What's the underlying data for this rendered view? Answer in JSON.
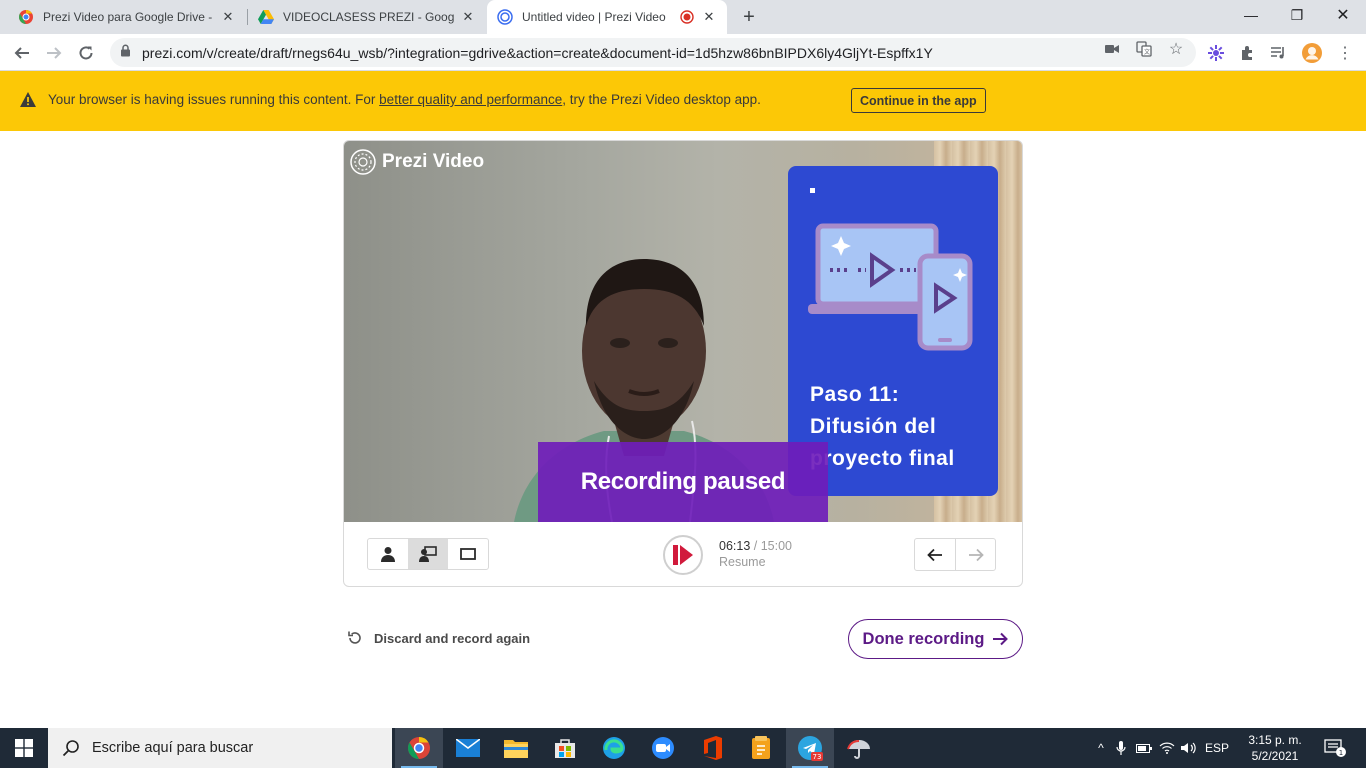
{
  "browser": {
    "tabs": [
      {
        "title": "Prezi Video para Google Drive - C",
        "active": false
      },
      {
        "title": "VIDEOCLASESS PREZI - Google Dr",
        "active": false
      },
      {
        "title": "Untitled video | Prezi Video",
        "active": true
      }
    ],
    "url": "prezi.com/v/create/draft/rnegs64u_wsb/?integration=gdrive&action=create&document-id=1d5hzw86bnBIPDX6ly4GljYt-Espffx1Y"
  },
  "banner": {
    "message_prefix": "Your browser is having issues running this content. For ",
    "link_text": "better quality and performance",
    "message_suffix": ", try the Prezi Video desktop app.",
    "button_label": "Continue in the app"
  },
  "video": {
    "logo_text": "Prezi Video",
    "slide_heading_line1": "Paso 11:",
    "slide_heading_line2": "Difusión del",
    "slide_heading_line3": "proyecto final",
    "overlay_text": "Recording paused"
  },
  "controls": {
    "elapsed": "06:13",
    "total": "/ 15:00",
    "status": "Resume"
  },
  "actions": {
    "discard_label": "Discard and record again",
    "done_label": "Done recording"
  },
  "taskbar": {
    "search_placeholder": "Escribe aquí para buscar",
    "language": "ESP",
    "time": "3:15 p. m.",
    "date": "5/2/2021",
    "telegram_badge": "73",
    "notification_count": "1"
  },
  "colors": {
    "banner_bg": "#fcc806",
    "overlay_purple": "#6f1dba",
    "done_accent": "#5c1a86",
    "slide_blue": "#2d49d2",
    "record_red": "#d11a3c"
  }
}
